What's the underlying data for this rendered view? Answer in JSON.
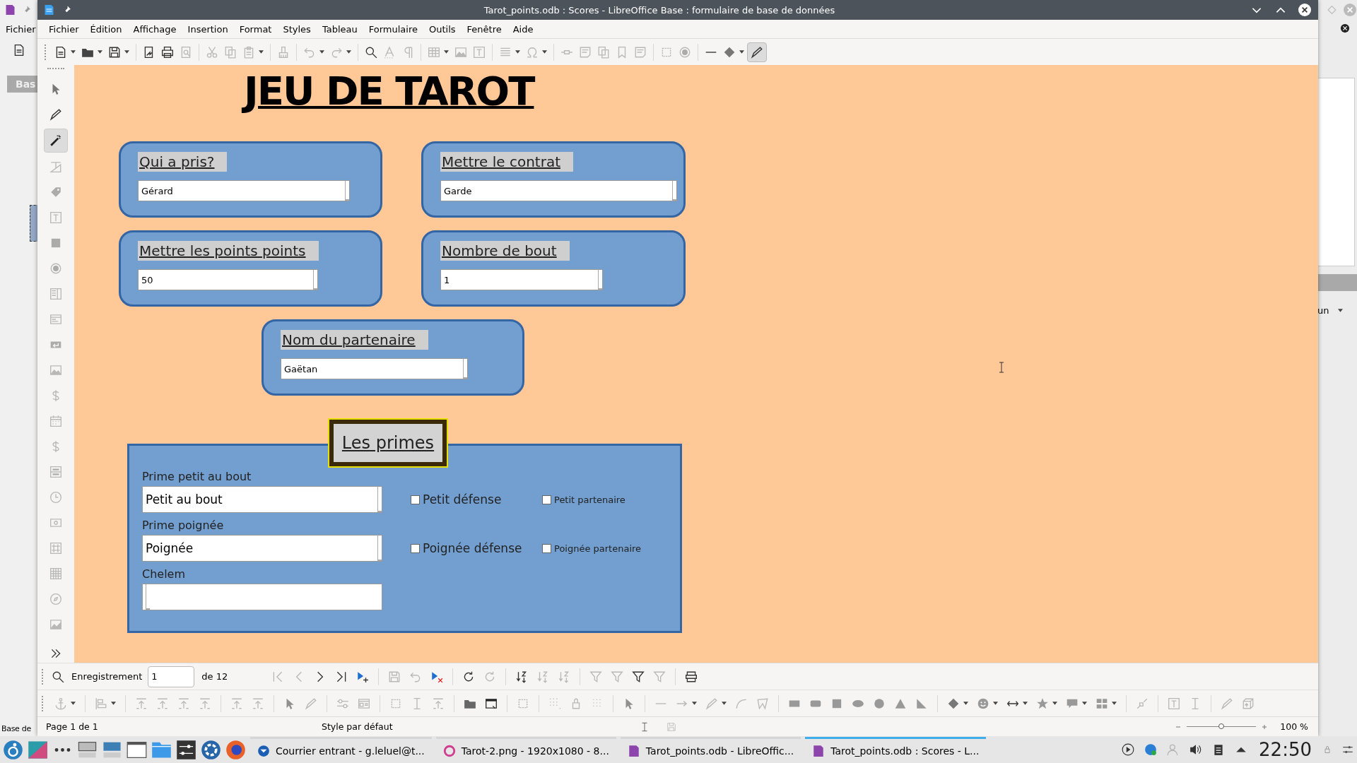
{
  "background_window": {
    "menu_item": "Fichier",
    "tab": "Bas",
    "status": "Base de",
    "dropdown": "un"
  },
  "window": {
    "title": "Tarot_points.odb : Scores - LibreOffice Base : formulaire de base de données"
  },
  "menu": [
    "Fichier",
    "Édition",
    "Affichage",
    "Insertion",
    "Format",
    "Styles",
    "Tableau",
    "Formulaire",
    "Outils",
    "Fenêtre",
    "Aide"
  ],
  "form": {
    "title": "JEU DE TAROT",
    "fields": [
      {
        "label": "Qui a pris?",
        "value": "Gérard"
      },
      {
        "label": "Mettre le contrat",
        "value": "Garde"
      },
      {
        "label": "Mettre les points points",
        "value": "50"
      },
      {
        "label": "Nombre de bout",
        "value": "1"
      },
      {
        "label": "Nom du partenaire",
        "value": "Gaëtan"
      }
    ],
    "primes": {
      "title": "Les primes",
      "rows": [
        {
          "label": "Prime petit au bout",
          "value": "Petit au bout",
          "checkboxes": [
            {
              "label": "Petit défense",
              "checked": false
            },
            {
              "label": "Petit partenaire",
              "checked": false
            }
          ]
        },
        {
          "label": "Prime poignée",
          "value": "Poignée",
          "checkboxes": [
            {
              "label": "Poignée défense",
              "checked": false
            },
            {
              "label": "Poignée partenaire",
              "checked": false
            }
          ]
        },
        {
          "label": "Chelem",
          "checkboxes": []
        }
      ]
    }
  },
  "record_bar": {
    "label": "Enregistrement",
    "value": "1",
    "total": "de 12"
  },
  "status_bar": {
    "page": "Page 1 de 1",
    "style": "Style par défaut",
    "zoom": {
      "level": 0.5,
      "reading": "100 %"
    }
  },
  "taskbar": {
    "tasks": [
      {
        "label": "Courrier entrant - g.leluel@t...",
        "selected": false
      },
      {
        "label": "Tarot-2.png - 1920x1080 - 8...",
        "selected": false
      },
      {
        "label": "Tarot_points.odb - LibreOffic...",
        "selected": false
      },
      {
        "label": "Tarot_points.odb : Scores - L...",
        "selected": true
      }
    ],
    "clock": "22:50"
  }
}
